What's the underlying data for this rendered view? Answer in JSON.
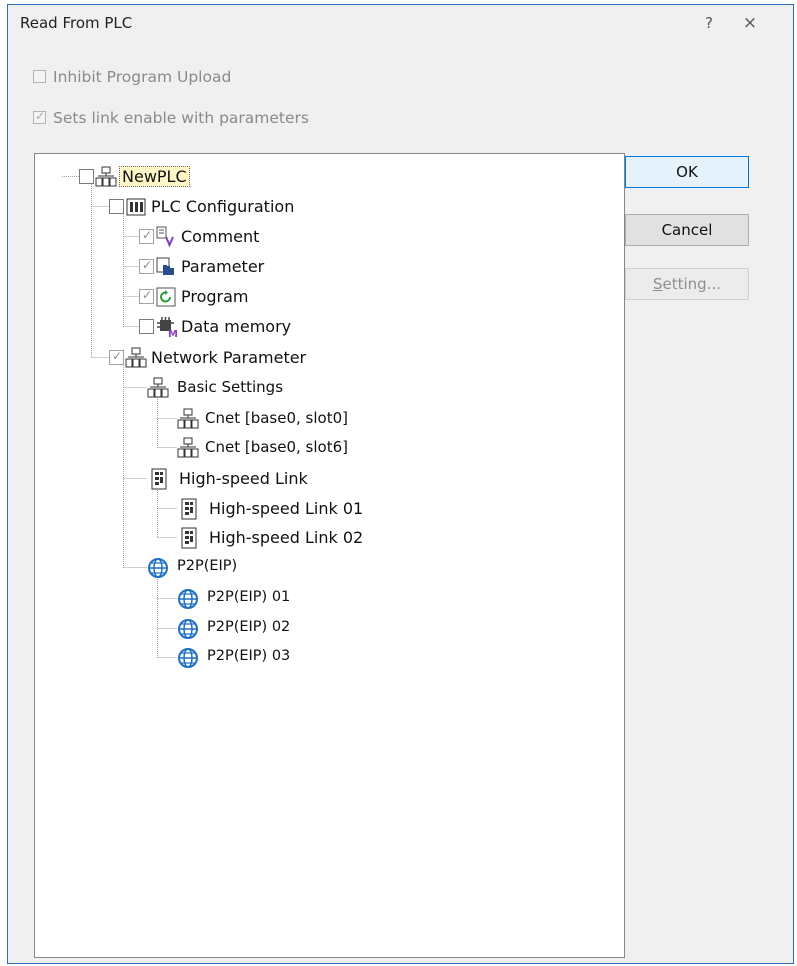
{
  "dialog": {
    "title": "Read From PLC",
    "help_label": "?",
    "close_label": "×"
  },
  "options": {
    "inhibit_upload": {
      "label": "Inhibit Program Upload",
      "checked": false,
      "enabled": false
    },
    "link_enable": {
      "label": "Sets link enable with parameters",
      "checked": true,
      "enabled": false
    }
  },
  "buttons": {
    "ok": "OK",
    "cancel": "Cancel",
    "setting_mnemonic": "S",
    "setting_rest": "etting..."
  },
  "tree": {
    "root": "NewPLC",
    "plc_config": "PLC Configuration",
    "comment": "Comment",
    "parameter": "Parameter",
    "program": "Program",
    "data_memory": "Data memory",
    "network_param": "Network Parameter",
    "basic_settings": "Basic Settings",
    "cnet_slot0": "Cnet [base0, slot0]",
    "cnet_slot6": "Cnet [base0, slot6]",
    "hs_link": "High-speed Link",
    "hs_link_01": "High-speed Link 01",
    "hs_link_02": "High-speed Link 02",
    "p2p": "P2P(EIP)",
    "p2p_01": "P2P(EIP) 01",
    "p2p_02": "P2P(EIP) 02",
    "p2p_03": "P2P(EIP) 03"
  },
  "colors": {
    "accent_border": "#0078d7",
    "network_icon_blue": "#1f6fc4",
    "comment_icon_purple": "#7b3fc6",
    "memory_icon_purple": "#8e3bc0",
    "program_icon_green": "#2e9c3a"
  }
}
